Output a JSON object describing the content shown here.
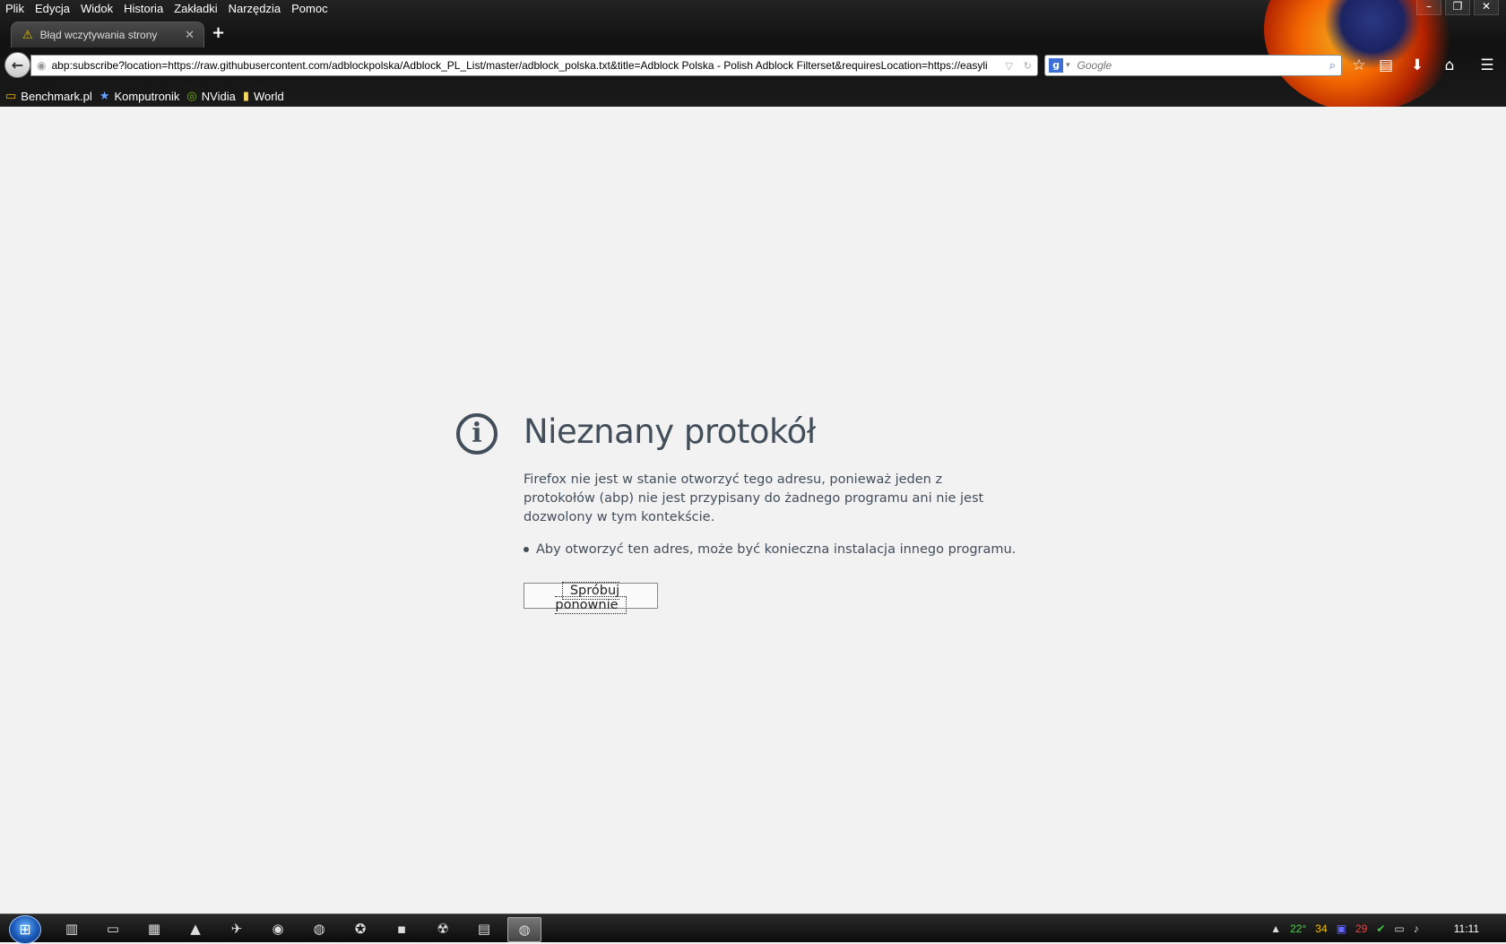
{
  "menubar": [
    "Plik",
    "Edycja",
    "Widok",
    "Historia",
    "Zakładki",
    "Narzędzia",
    "Pomoc"
  ],
  "tab": {
    "title": "Błąd wczytywania strony",
    "icon": "warning-icon"
  },
  "urlbar": {
    "url": "abp:subscribe?location=https://raw.githubusercontent.com/adblockpolska/Adblock_PL_List/master/adblock_polska.txt&title=Adblock Polska - Polish Adblock Filterset&requiresLocation=https://easyli"
  },
  "search": {
    "placeholder": "Google",
    "engine": "Google"
  },
  "bookmarks": [
    {
      "label": "Benchmark.pl",
      "icon": "folder-icon"
    },
    {
      "label": "Komputronik",
      "icon": "star-icon"
    },
    {
      "label": "NVidia",
      "icon": "nvidia-icon"
    },
    {
      "label": "World",
      "icon": "folder-icon"
    }
  ],
  "error": {
    "title": "Nieznany protokół",
    "description": "Firefox nie jest w stanie otworzyć tego adresu, ponieważ jeden z protokołów (abp) nie jest przypisany do żadnego programu ani nie jest dozwolony w tym kontekście.",
    "hint": "Aby otworzyć ten adres, może być konieczna instalacja innego programu.",
    "retry_label": "Spróbuj ponownie"
  },
  "tray": {
    "temp1": "22°",
    "temp2": "34",
    "temp3": "29",
    "clock": "11:11"
  },
  "colors": {
    "error_text": "#424e5a",
    "page_bg": "#f2f2f2",
    "chrome_bg": "#111111"
  }
}
